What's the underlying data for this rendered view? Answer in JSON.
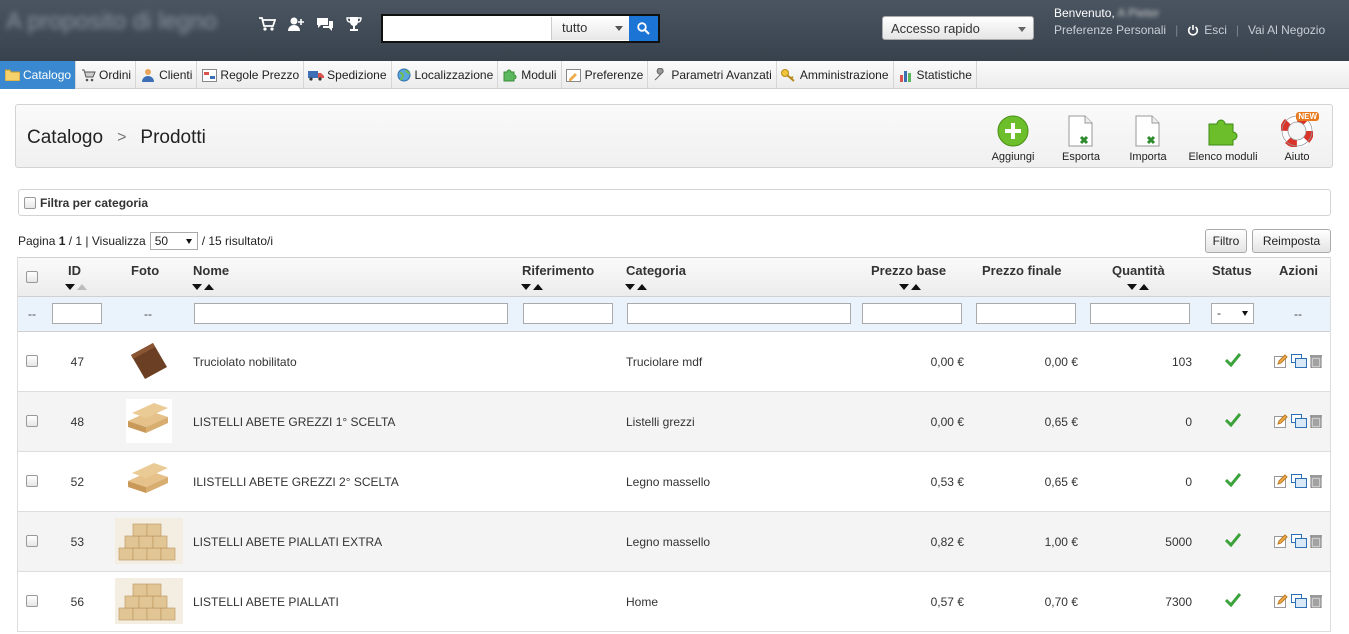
{
  "header": {
    "shop_name": "A proposito di legno",
    "search": {
      "value": "",
      "scope": "tutto"
    },
    "quick_access": "Accesso rapido",
    "welcome_prefix": "Benvenuto,",
    "welcome_name": "A Pieter",
    "links": {
      "preferences": "Preferenze Personali",
      "logout": "Esci",
      "shop": "Vai Al Negozio"
    }
  },
  "tabs": [
    {
      "label": "Catalogo",
      "icon": "folder-icon"
    },
    {
      "label": "Ordini",
      "icon": "cart-icon"
    },
    {
      "label": "Clienti",
      "icon": "user-icon"
    },
    {
      "label": "Regole Prezzo",
      "icon": "price-rules-icon"
    },
    {
      "label": "Spedizione",
      "icon": "truck-icon"
    },
    {
      "label": "Localizzazione",
      "icon": "globe-icon"
    },
    {
      "label": "Moduli",
      "icon": "puzzle-icon"
    },
    {
      "label": "Preferenze",
      "icon": "preferences-icon"
    },
    {
      "label": "Parametri Avanzati",
      "icon": "wrench-icon"
    },
    {
      "label": "Amministrazione",
      "icon": "key-icon"
    },
    {
      "label": "Statistiche",
      "icon": "chart-icon"
    }
  ],
  "breadcrumb": {
    "section": "Catalogo",
    "separator": ">",
    "page": "Prodotti"
  },
  "toolbar": {
    "add": "Aggiungi",
    "export": "Esporta",
    "import": "Importa",
    "modules": "Elenco moduli",
    "help": "Aiuto",
    "help_badge": "NEW"
  },
  "category_filter": "Filtra per categoria",
  "pagination": {
    "prefix": "Pagina",
    "current": "1",
    "total": "/ 1 | Visualizza",
    "per_page": "50",
    "results": "/ 15 risultato/i"
  },
  "buttons": {
    "filter": "Filtro",
    "reset": "Reimposta"
  },
  "table": {
    "columns": {
      "id": "ID",
      "photo": "Foto",
      "name": "Nome",
      "reference": "Riferimento",
      "category": "Categoria",
      "base_price": "Prezzo base",
      "final_price": "Prezzo finale",
      "quantity": "Quantità",
      "status": "Status",
      "actions": "Azioni"
    },
    "filter_placeholder": "--",
    "status_filter": "-",
    "rows": [
      {
        "id": "47",
        "name": "Truciolato nobilitato",
        "reference": "",
        "category": "Truciolare mdf",
        "base_price": "0,00 €",
        "final_price": "0,00 €",
        "quantity": "103"
      },
      {
        "id": "48",
        "name": "LISTELLI ABETE GREZZI 1° SCELTA",
        "reference": "",
        "category": "Listelli grezzi",
        "base_price": "0,00 €",
        "final_price": "0,65 €",
        "quantity": "0"
      },
      {
        "id": "52",
        "name": "ILISTELLI ABETE GREZZI 2° SCELTA",
        "reference": "",
        "category": "Legno massello",
        "base_price": "0,53 €",
        "final_price": "0,65 €",
        "quantity": "0"
      },
      {
        "id": "53",
        "name": "LISTELLI ABETE PIALLATI EXTRA",
        "reference": "",
        "category": "Legno massello",
        "base_price": "0,82 €",
        "final_price": "1,00 €",
        "quantity": "5000"
      },
      {
        "id": "56",
        "name": "LISTELLI ABETE PIALLATI",
        "reference": "",
        "category": "Home",
        "base_price": "0,57 €",
        "final_price": "0,70 €",
        "quantity": "7300"
      }
    ]
  }
}
